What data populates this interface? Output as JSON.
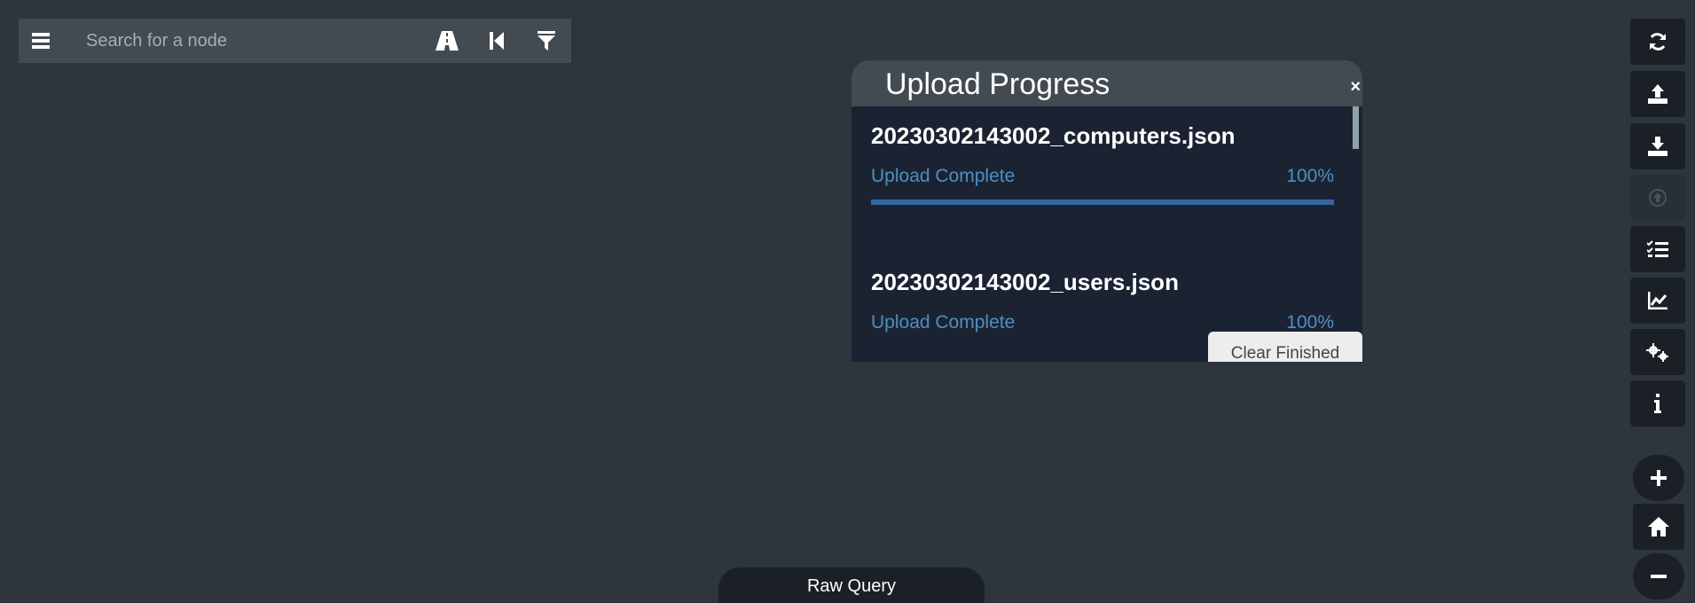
{
  "search": {
    "placeholder": "Search for a node",
    "menu_icon": "hamburger-menu-icon",
    "buttons": [
      "pathfinding-road-icon",
      "back-step-icon",
      "filter-icon"
    ]
  },
  "toolbar": {
    "buttons": [
      {
        "icon": "refresh-icon",
        "enabled": true
      },
      {
        "icon": "upload-icon",
        "enabled": true
      },
      {
        "icon": "download-icon",
        "enabled": true
      },
      {
        "icon": "circle-arrow-up-icon",
        "enabled": false
      },
      {
        "icon": "checklist-icon",
        "enabled": true
      },
      {
        "icon": "line-chart-icon",
        "enabled": true
      },
      {
        "icon": "gears-icon",
        "enabled": true
      },
      {
        "icon": "info-icon",
        "enabled": true
      }
    ],
    "zoom": [
      "plus-icon",
      "home-icon",
      "minus-icon"
    ]
  },
  "upload_panel": {
    "title": "Upload Progress",
    "close": "×",
    "items": [
      {
        "file": "20230302143002_computers.json",
        "status": "Upload Complete",
        "percent": "100%",
        "progress": 1.0
      },
      {
        "file": "20230302143002_users.json",
        "status": "Upload Complete",
        "percent": "100%",
        "progress": 1.0
      }
    ],
    "clear_label": "Clear Finished"
  },
  "raw_query": {
    "label": "Raw Query"
  },
  "colors": {
    "background": "#2c363c",
    "panel": "#1b2333",
    "accent": "#4f8fbe",
    "progress": "#3568a0"
  }
}
